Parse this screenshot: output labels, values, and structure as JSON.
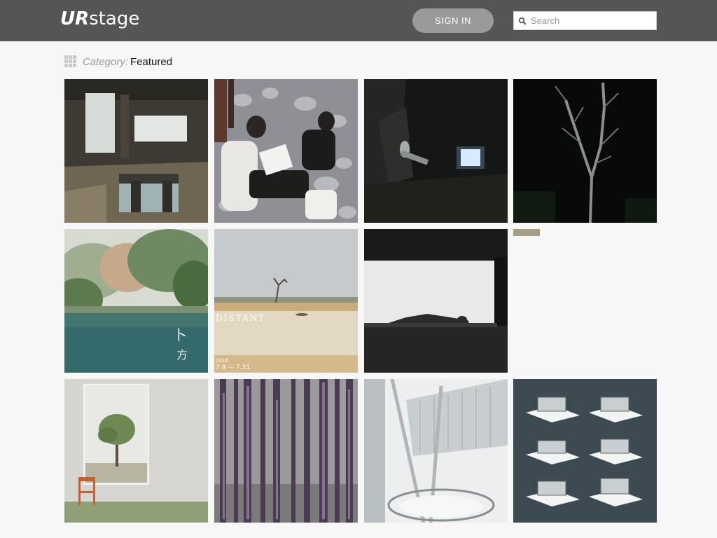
{
  "header": {
    "logo_bold": "UR",
    "logo_rest": "stage",
    "signin_label": "SIGN IN",
    "search_placeholder": "Search"
  },
  "breadcrumb": {
    "label": "Category:",
    "value": "Featured"
  },
  "gallery": {
    "items": [
      {
        "id": "abandoned-room-pool"
      },
      {
        "id": "two-people-on-rocks"
      },
      {
        "id": "night-figure-with-screen"
      },
      {
        "id": "bare-tree-at-night"
      },
      {
        "id": "forest-lake"
      },
      {
        "id": "distant-poster",
        "title": "DISTANT",
        "date": "2016",
        "range": "7.9 — 7.31"
      },
      {
        "id": "person-lying-by-window"
      },
      {
        "id": "small-thumbnail"
      },
      {
        "id": "tree-in-frame-with-chair"
      },
      {
        "id": "purple-forest"
      },
      {
        "id": "white-architecture"
      },
      {
        "id": "architecture-models"
      }
    ]
  },
  "colors": {
    "topbar": "#555555",
    "signin_bg": "#9a9a9a",
    "page_bg": "#f7f7f7"
  }
}
